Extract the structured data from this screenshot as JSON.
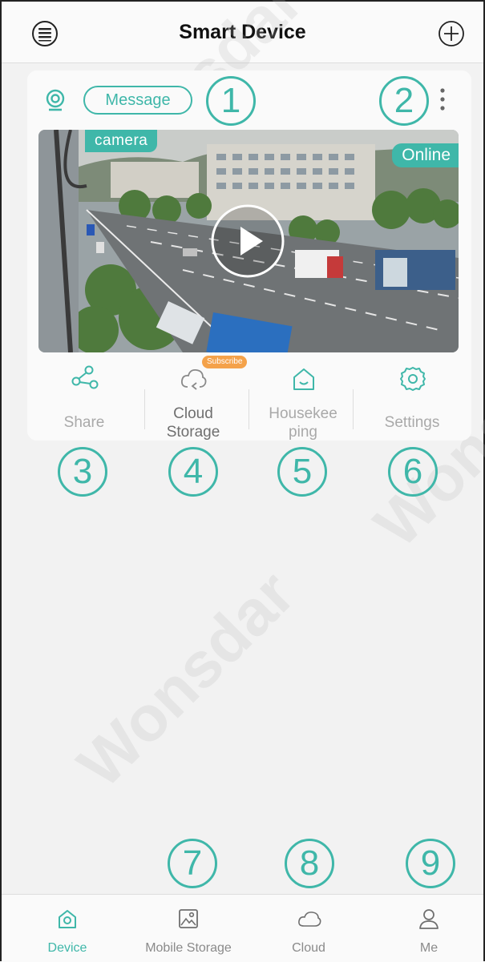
{
  "header": {
    "title": "Smart Device",
    "menu_icon": "menu-list-icon",
    "add_icon": "plus-circle-icon"
  },
  "device_card": {
    "camera_icon": "webcam-icon",
    "message_label": "Message",
    "more_icon": "more-vertical-icon",
    "camera_name": "camera",
    "status": "Online",
    "play_icon": "play-icon",
    "actions": [
      {
        "label": "Share",
        "icon": "share-icon"
      },
      {
        "label": "Cloud\nStorage",
        "icon": "cloud-icon",
        "badge": "Subscribe"
      },
      {
        "label": "Housekee\nping",
        "icon": "home-icon"
      },
      {
        "label": "Settings",
        "icon": "gear-icon"
      }
    ]
  },
  "callouts": [
    "1",
    "2",
    "3",
    "4",
    "5",
    "6",
    "7",
    "8",
    "9"
  ],
  "tabs": [
    {
      "label": "Device",
      "icon": "device-home-icon"
    },
    {
      "label": "Mobile Storage",
      "icon": "image-icon"
    },
    {
      "label": "Cloud",
      "icon": "cloud-icon"
    },
    {
      "label": "Me",
      "icon": "user-icon"
    }
  ],
  "colors": {
    "accent": "#3fb7a9",
    "badge": "#f4a24a"
  }
}
